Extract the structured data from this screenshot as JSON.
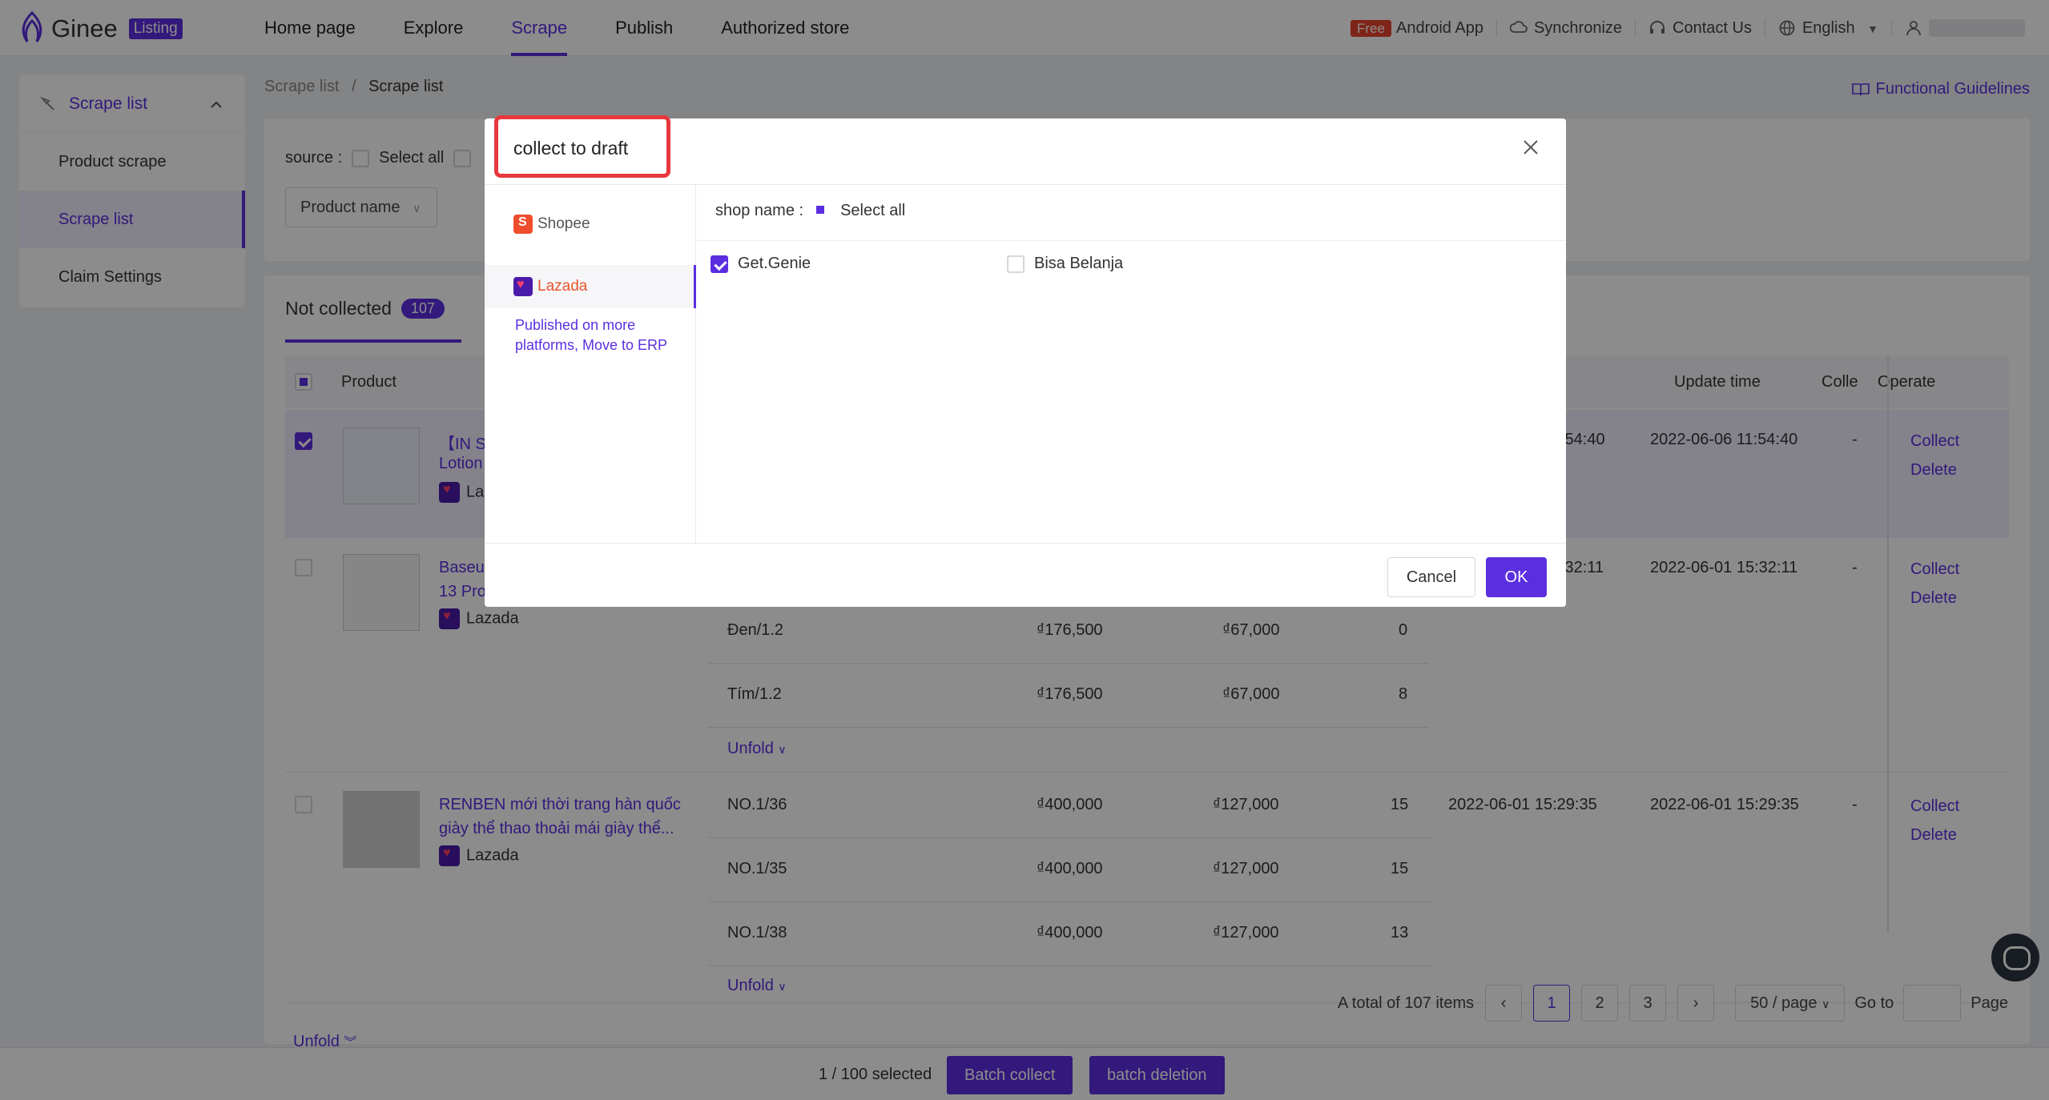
{
  "header": {
    "logo_text": "Ginee",
    "logo_badge": "Listing",
    "nav": [
      "Home page",
      "Explore",
      "Scrape",
      "Publish",
      "Authorized store"
    ],
    "active_nav": "Scrape",
    "free_badge": "Free",
    "android_app": "Android App",
    "synchronize": "Synchronize",
    "contact_us": "Contact Us",
    "language": "English"
  },
  "sidebar": {
    "section": "Scrape list",
    "items": [
      "Product scrape",
      "Scrape list",
      "Claim Settings"
    ],
    "active": "Scrape list"
  },
  "breadcrumb": {
    "parent": "Scrape list",
    "current": "Scrape list"
  },
  "guide_link": "Functional Guidelines",
  "filter": {
    "source_label": "source :",
    "select_all": "Select all",
    "product_name": "Product name"
  },
  "table": {
    "tab_label": "Not collected",
    "tab_count": "107",
    "columns": {
      "product": "Product",
      "update_time": "Update time",
      "collect": "Colle",
      "operate": "Operate"
    },
    "rows": [
      {
        "title_1": "【IN S",
        "title_2": "Lotion",
        "platform": "La",
        "create": ":54:40",
        "update": "2022-06-06 11:54:40",
        "collect": "-",
        "ops": [
          "Collect",
          "Delete"
        ]
      },
      {
        "title_1": "Baseu",
        "title_2": "13 Pro",
        "platform": "Lazada",
        "create": ":32:11",
        "update": "2022-06-01 15:32:11",
        "collect": "-",
        "ops": [
          "Collect",
          "Delete"
        ],
        "variants": [
          {
            "name": "Đen/1.2",
            "price": "₫176,500",
            "sale": "₫67,000",
            "stock": "0"
          },
          {
            "name": "Tím/1.2",
            "price": "₫176,500",
            "sale": "₫67,000",
            "stock": "8"
          }
        ]
      },
      {
        "title_1": "RENBEN mới thời trang hàn quốc",
        "title_2": "giày thể thao thoải mái giày thể...",
        "platform": "Lazada",
        "create": "2022-06-01 15:29:35",
        "update": "2022-06-01 15:29:35",
        "collect": "-",
        "ops": [
          "Collect",
          "Delete"
        ],
        "variants": [
          {
            "name": "NO.1/36",
            "price": "₫400,000",
            "sale": "₫127,000",
            "stock": "15"
          },
          {
            "name": "NO.1/35",
            "price": "₫400,000",
            "sale": "₫127,000",
            "stock": "15"
          },
          {
            "name": "NO.1/38",
            "price": "₫400,000",
            "sale": "₫127,000",
            "stock": "13"
          }
        ]
      }
    ],
    "unfold": "Unfold"
  },
  "pagination": {
    "total": "A total of 107 items",
    "pages": [
      "1",
      "2",
      "3"
    ],
    "current": "1",
    "page_size": "50 / page",
    "goto": "Go to",
    "page_suffix": "Page"
  },
  "bottom_bar": {
    "selected": "1 / 100 selected",
    "batch_collect": "Batch collect",
    "batch_delete": "batch deletion"
  },
  "modal": {
    "title": "collect to draft",
    "platforms": [
      "Shopee",
      "Lazada"
    ],
    "active_platform": "Lazada",
    "note": "Published on more platforms,   Move to ERP",
    "shop_name_label": "shop name :",
    "select_all": "Select all",
    "shops": [
      {
        "name": "Get.Genie",
        "checked": true
      },
      {
        "name": "Bisa Belanja",
        "checked": false
      }
    ],
    "cancel": "Cancel",
    "ok": "OK"
  },
  "colors": {
    "primary": "#5b2fe0",
    "highlight": "#e8383d",
    "shopee": "#ee4d2d"
  }
}
